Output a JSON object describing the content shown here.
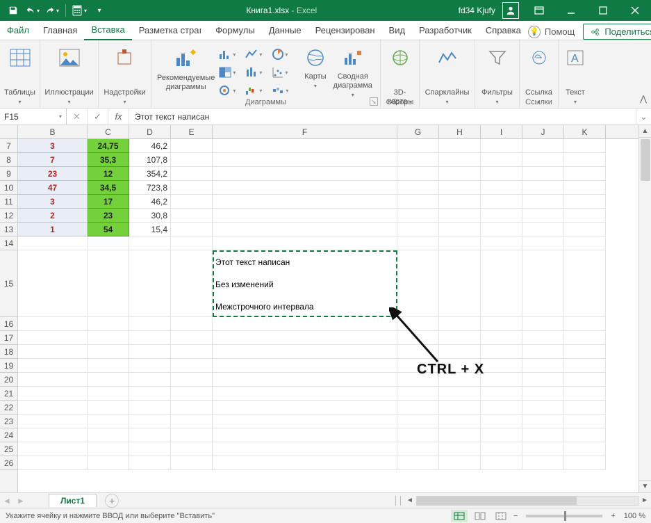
{
  "title": {
    "doc": "Книга1.xlsx",
    "sep": "  -  ",
    "app": "Excel"
  },
  "user": "fd34 Kjufy",
  "tabs": {
    "file": "Файл",
    "items": [
      "Главная",
      "Вставка",
      "Разметка страı",
      "Формулы",
      "Данные",
      "Рецензирован",
      "Вид",
      "Разработчик",
      "Справка"
    ],
    "active_index": 1,
    "help_hint": "Помощ",
    "share": "Поделиться"
  },
  "ribbon": {
    "tables": "Таблицы",
    "illustrations": "Иллюстрации",
    "addins": "Надстройки",
    "rec_charts_l1": "Рекомендуемые",
    "rec_charts_l2": "диаграммы",
    "charts_group": "Диаграммы",
    "maps": "Карты",
    "pivotchart_l1": "Сводная",
    "pivotchart_l2": "диаграмма",
    "map3d_l1": "3D-",
    "map3d_l2": "карта",
    "tours": "Обзоры",
    "sparklines": "Спарклайны",
    "filters": "Фильтры",
    "link": "Ссылка",
    "links_group": "Ссылки",
    "text": "Текст"
  },
  "formula_bar": {
    "name": "F15",
    "value": "Этот текст написан"
  },
  "columns": [
    "B",
    "C",
    "D",
    "E",
    "F",
    "G",
    "H",
    "I",
    "J",
    "K"
  ],
  "col_widths": {
    "B": 100,
    "C": 60,
    "D": 60,
    "E": 60,
    "F": 266,
    "G": 60,
    "H": 60,
    "I": 60,
    "J": 60,
    "K": 60
  },
  "rows_hdr": [
    "7",
    "8",
    "9",
    "10",
    "11",
    "12",
    "13",
    "14",
    "15",
    "16",
    "17",
    "18",
    "19",
    "20",
    "21",
    "22",
    "23",
    "24",
    "25",
    "26"
  ],
  "data_rows": [
    {
      "b": "3",
      "c": "24,75",
      "d": "46,2"
    },
    {
      "b": "7",
      "c": "35,3",
      "d": "107,8"
    },
    {
      "b": "23",
      "c": "12",
      "d": "354,2"
    },
    {
      "b": "47",
      "c": "34,5",
      "d": "723,8"
    },
    {
      "b": "3",
      "c": "17",
      "d": "46,2"
    },
    {
      "b": "2",
      "c": "23",
      "d": "30,8"
    },
    {
      "b": "1",
      "c": "54",
      "d": "15,4"
    }
  ],
  "f15_lines": [
    "Этот текст написан",
    "Без изменений",
    "Межстрочного интервала"
  ],
  "annotation": "CTRL  +  X",
  "sheet": {
    "name": "Лист1"
  },
  "status": {
    "msg": "Укажите ячейку и нажмите ВВОД или выберите \"Вставить\"",
    "zoom": "100 %"
  }
}
